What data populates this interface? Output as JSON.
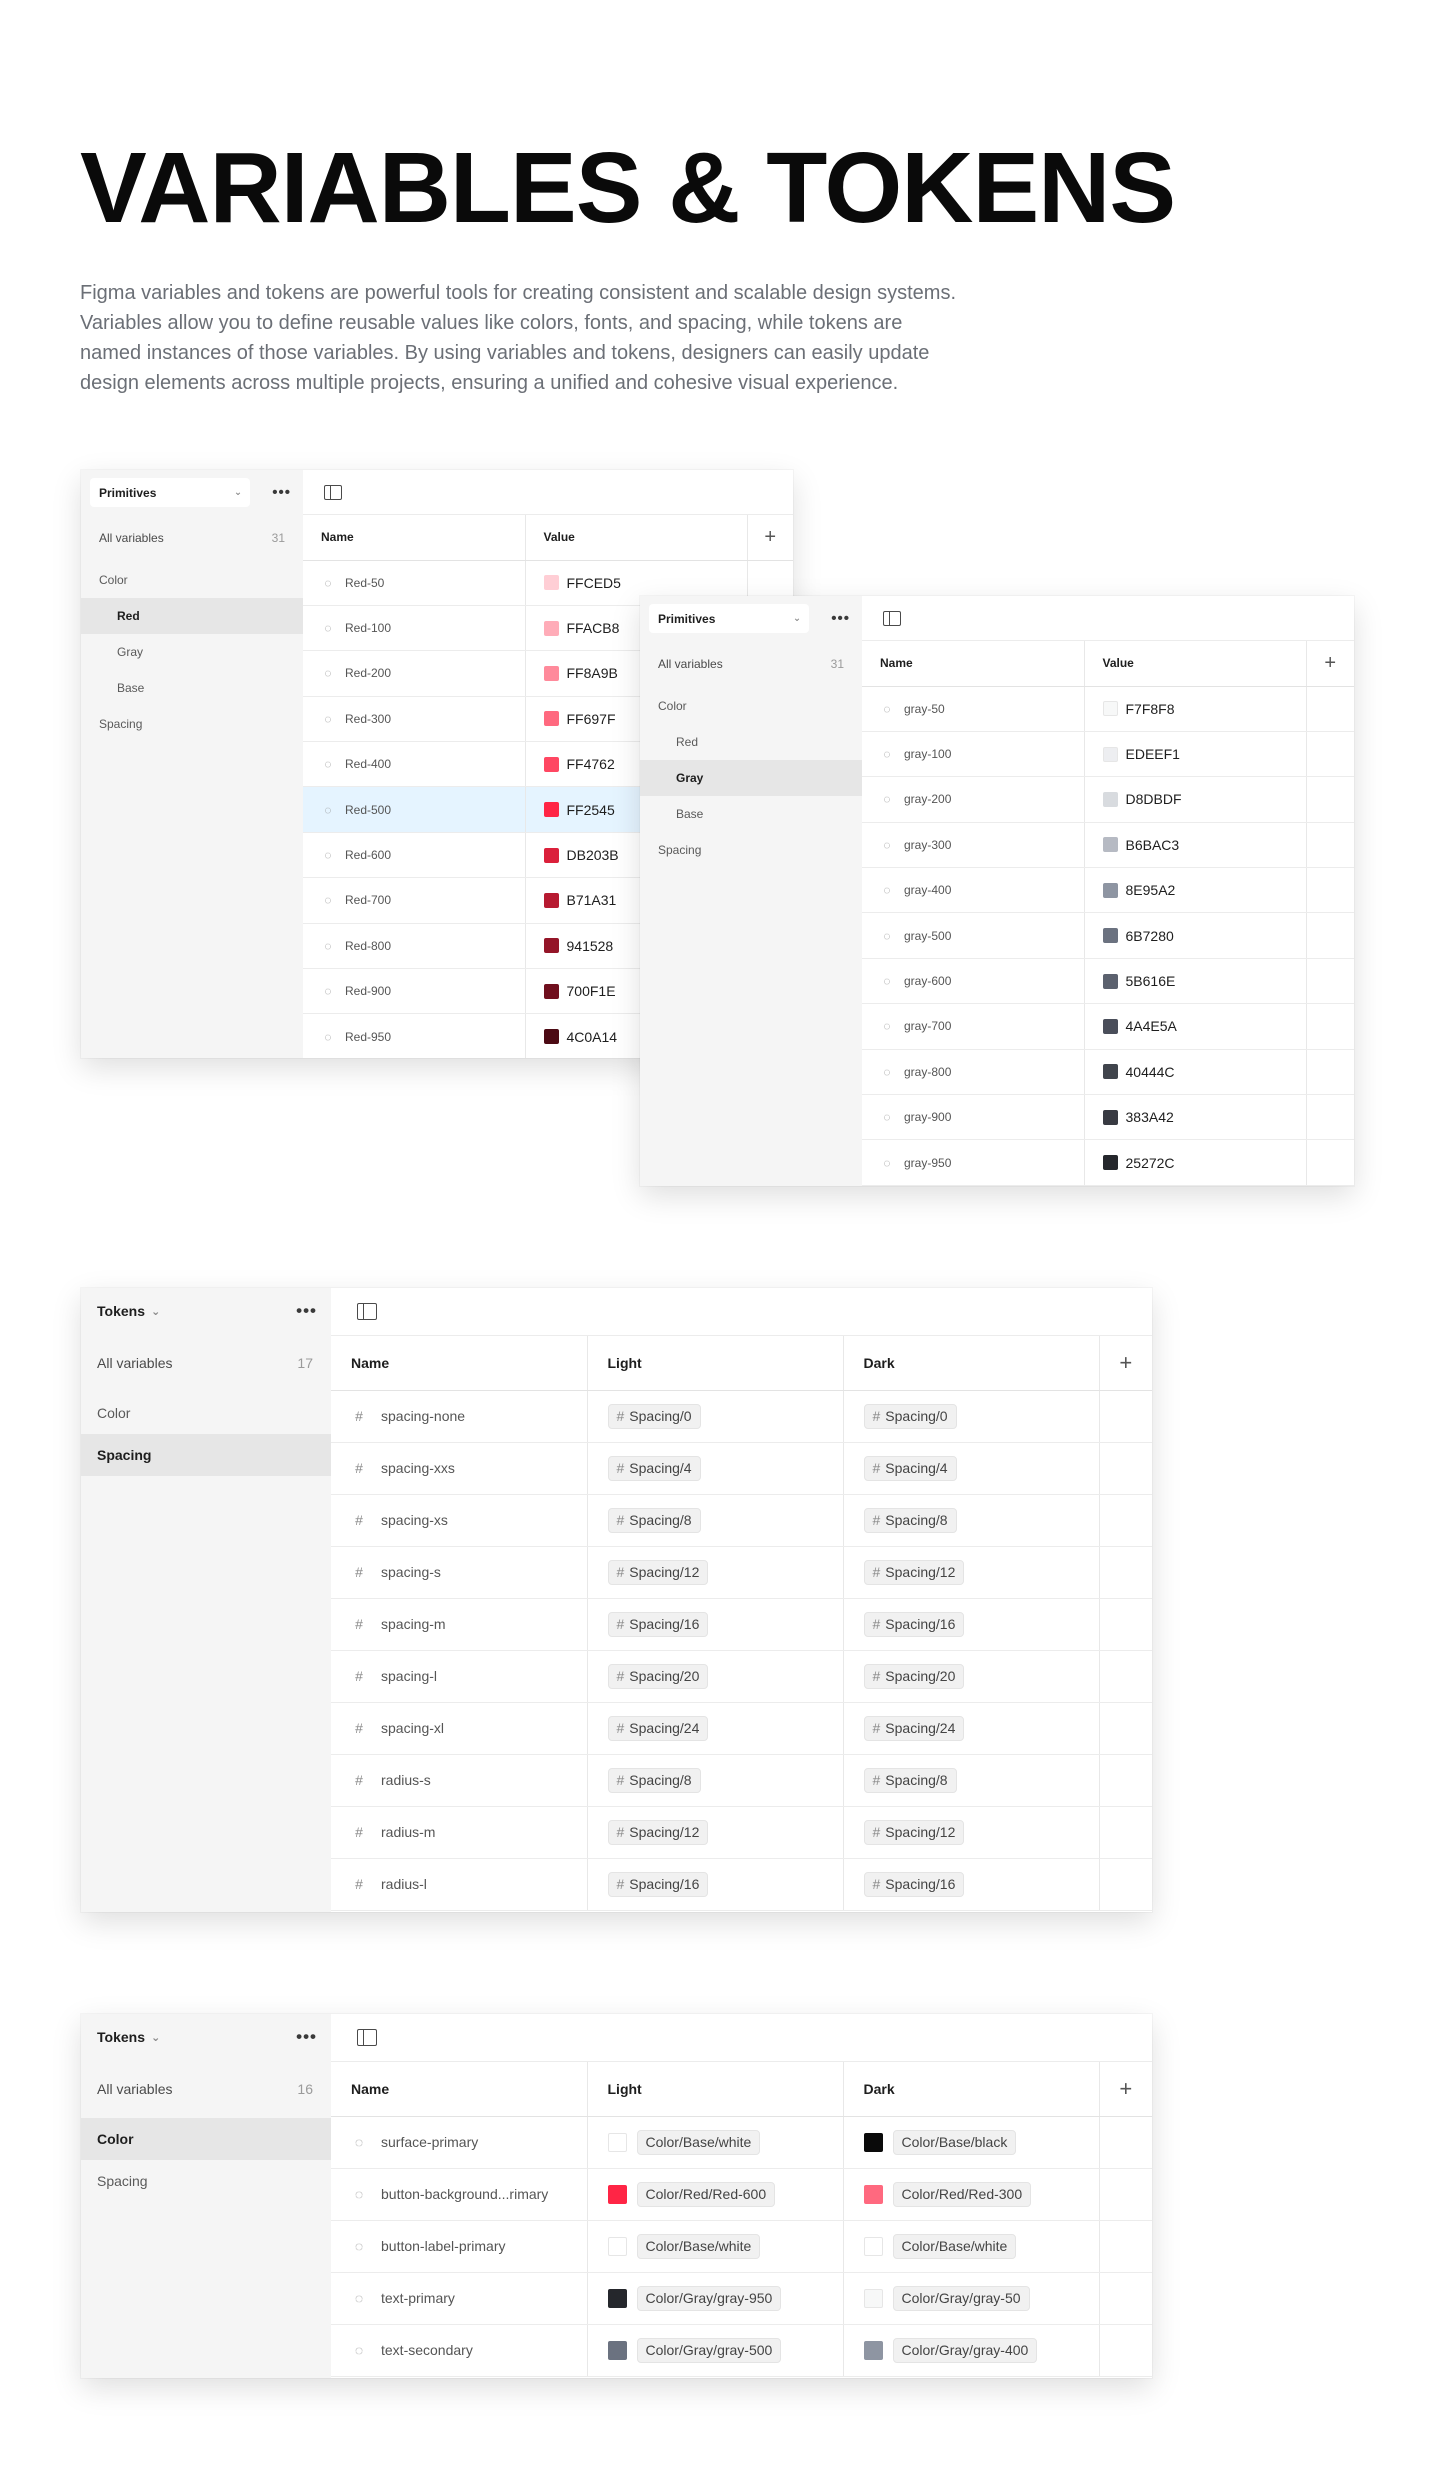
{
  "hero": {
    "title": "VARIABLES & TOKENS",
    "description": "Figma variables and tokens are powerful tools for creating consistent and scalable design systems. Variables allow you to define reusable values like colors, fonts, and spacing, while tokens are named instances of those variables. By using variables and tokens, designers can easily update design elements across multiple projects, ensuring a unified and cohesive visual experience."
  },
  "panel_red": {
    "collection": "Primitives",
    "all_label": "All variables",
    "all_count": "31",
    "groups": {
      "color": "Color",
      "red": "Red",
      "gray": "Gray",
      "base": "Base",
      "spacing": "Spacing"
    },
    "headers": {
      "name": "Name",
      "value": "Value",
      "add": "+"
    },
    "rows": [
      {
        "name": "Red-50",
        "value": "FFCED5",
        "color": "#FFCED5"
      },
      {
        "name": "Red-100",
        "value": "FFACB8",
        "color": "#FFACB8"
      },
      {
        "name": "Red-200",
        "value": "FF8A9B",
        "color": "#FF8A9B"
      },
      {
        "name": "Red-300",
        "value": "FF697F",
        "color": "#FF697F"
      },
      {
        "name": "Red-400",
        "value": "FF4762",
        "color": "#FF4762"
      },
      {
        "name": "Red-500",
        "value": "FF2545",
        "color": "#FF2545"
      },
      {
        "name": "Red-600",
        "value": "DB203B",
        "color": "#DB203B"
      },
      {
        "name": "Red-700",
        "value": "B71A31",
        "color": "#B71A31"
      },
      {
        "name": "Red-800",
        "value": "941528",
        "color": "#941528"
      },
      {
        "name": "Red-900",
        "value": "700F1E",
        "color": "#700F1E"
      },
      {
        "name": "Red-950",
        "value": "4C0A14",
        "color": "#4C0A14"
      }
    ]
  },
  "panel_gray": {
    "collection": "Primitives",
    "all_label": "All variables",
    "all_count": "31",
    "groups": {
      "color": "Color",
      "red": "Red",
      "gray": "Gray",
      "base": "Base",
      "spacing": "Spacing"
    },
    "headers": {
      "name": "Name",
      "value": "Value",
      "add": "+"
    },
    "rows": [
      {
        "name": "gray-50",
        "value": "F7F8F8",
        "color": "#F7F8F8"
      },
      {
        "name": "gray-100",
        "value": "EDEEF1",
        "color": "#EDEEF1"
      },
      {
        "name": "gray-200",
        "value": "D8DBDF",
        "color": "#D8DBDF"
      },
      {
        "name": "gray-300",
        "value": "B6BAC3",
        "color": "#B6BAC3"
      },
      {
        "name": "gray-400",
        "value": "8E95A2",
        "color": "#8E95A2"
      },
      {
        "name": "gray-500",
        "value": "6B7280",
        "color": "#6B7280"
      },
      {
        "name": "gray-600",
        "value": "5B616E",
        "color": "#5B616E"
      },
      {
        "name": "gray-700",
        "value": "4A4E5A",
        "color": "#4A4E5A"
      },
      {
        "name": "gray-800",
        "value": "40444C",
        "color": "#40444C"
      },
      {
        "name": "gray-900",
        "value": "383A42",
        "color": "#383A42"
      },
      {
        "name": "gray-950",
        "value": "25272C",
        "color": "#25272C"
      }
    ]
  },
  "panel_spacing": {
    "collection": "Tokens",
    "all_label": "All variables",
    "all_count": "17",
    "groups": {
      "color": "Color",
      "spacing": "Spacing"
    },
    "headers": {
      "name": "Name",
      "light": "Light",
      "dark": "Dark",
      "add": "+"
    },
    "rows": [
      {
        "name": "spacing-none",
        "light": "Spacing/0",
        "dark": "Spacing/0"
      },
      {
        "name": "spacing-xxs",
        "light": "Spacing/4",
        "dark": "Spacing/4"
      },
      {
        "name": "spacing-xs",
        "light": "Spacing/8",
        "dark": "Spacing/8"
      },
      {
        "name": "spacing-s",
        "light": "Spacing/12",
        "dark": "Spacing/12"
      },
      {
        "name": "spacing-m",
        "light": "Spacing/16",
        "dark": "Spacing/16"
      },
      {
        "name": "spacing-l",
        "light": "Spacing/20",
        "dark": "Spacing/20"
      },
      {
        "name": "spacing-xl",
        "light": "Spacing/24",
        "dark": "Spacing/24"
      },
      {
        "name": "radius-s",
        "light": "Spacing/8",
        "dark": "Spacing/8"
      },
      {
        "name": "radius-m",
        "light": "Spacing/12",
        "dark": "Spacing/12"
      },
      {
        "name": "radius-l",
        "light": "Spacing/16",
        "dark": "Spacing/16"
      }
    ]
  },
  "panel_color": {
    "collection": "Tokens",
    "all_label": "All variables",
    "all_count": "16",
    "groups": {
      "color": "Color",
      "spacing": "Spacing"
    },
    "headers": {
      "name": "Name",
      "light": "Light",
      "dark": "Dark",
      "add": "+"
    },
    "rows": [
      {
        "name": "surface-primary",
        "light": "Color/Base/white",
        "light_color": "#FFFFFF",
        "dark": "Color/Base/black",
        "dark_color": "#0A0A0A"
      },
      {
        "name": "button-background...rimary",
        "light": "Color/Red/Red-600",
        "light_color": "#FF2545",
        "dark": "Color/Red/Red-300",
        "dark_color": "#FF697F"
      },
      {
        "name": "button-label-primary",
        "light": "Color/Base/white",
        "light_color": "#FFFFFF",
        "dark": "Color/Base/white",
        "dark_color": "#FFFFFF"
      },
      {
        "name": "text-primary",
        "light": "Color/Gray/gray-950",
        "light_color": "#25272C",
        "dark": "Color/Gray/gray-50",
        "dark_color": "#F7F8F8"
      },
      {
        "name": "text-secondary",
        "light": "Color/Gray/gray-500",
        "light_color": "#6B7280",
        "dark": "Color/Gray/gray-400",
        "dark_color": "#8E95A2"
      }
    ]
  }
}
